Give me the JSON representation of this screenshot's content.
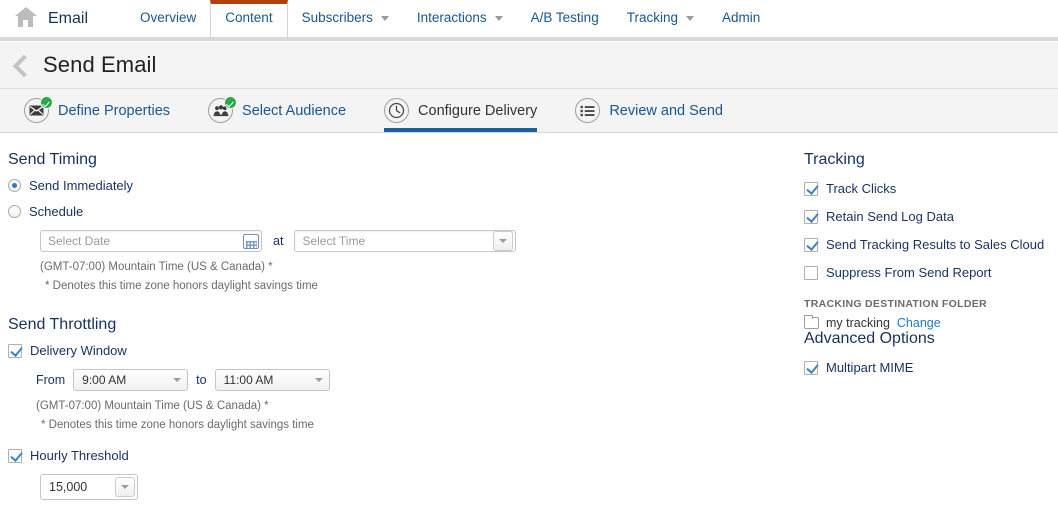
{
  "app": {
    "home_icon": "home-icon",
    "brand": "Email"
  },
  "nav": {
    "tabs": [
      {
        "label": "Overview",
        "has_caret": false,
        "active": false
      },
      {
        "label": "Content",
        "has_caret": false,
        "active": true
      },
      {
        "label": "Subscribers",
        "has_caret": true,
        "active": false
      },
      {
        "label": "Interactions",
        "has_caret": true,
        "active": false
      },
      {
        "label": "A/B Testing",
        "has_caret": false,
        "active": false
      },
      {
        "label": "Tracking",
        "has_caret": true,
        "active": false
      },
      {
        "label": "Admin",
        "has_caret": false,
        "active": false
      }
    ],
    "active_tab_accent": "#b1400d"
  },
  "header": {
    "back_icon": "back-chevron-icon",
    "title": "Send Email"
  },
  "steps": [
    {
      "label": "Define Properties",
      "icon": "envelope-icon",
      "complete": true,
      "active": false
    },
    {
      "label": "Select Audience",
      "icon": "audience-icon",
      "complete": true,
      "active": false
    },
    {
      "label": "Configure Delivery",
      "icon": "clock-icon",
      "complete": false,
      "active": true
    },
    {
      "label": "Review and Send",
      "icon": "list-icon",
      "complete": false,
      "active": false
    }
  ],
  "step_active_underline": "#1b5f9e",
  "send_timing": {
    "heading": "Send Timing",
    "options": [
      {
        "label": "Send Immediately",
        "selected": true
      },
      {
        "label": "Schedule",
        "selected": false
      }
    ],
    "date_placeholder": "Select Date",
    "at_label": "at",
    "time_placeholder": "Select Time",
    "timezone": "(GMT-07:00) Mountain Time (US & Canada) *",
    "timezone_note": "* Denotes this time zone honors daylight savings time"
  },
  "send_throttling": {
    "heading": "Send Throttling",
    "delivery_window": {
      "label": "Delivery Window",
      "checked": true
    },
    "from_label": "From",
    "from_value": "9:00 AM",
    "to_label": "to",
    "to_value": "11:00 AM",
    "timezone": "(GMT-07:00) Mountain Time (US & Canada) *",
    "timezone_note": "* Denotes this time zone honors daylight savings time",
    "hourly_threshold": {
      "label": "Hourly Threshold",
      "checked": true
    },
    "threshold_value": "15,000"
  },
  "tracking": {
    "heading": "Tracking",
    "options": [
      {
        "label": "Track Clicks",
        "checked": true
      },
      {
        "label": "Retain Send Log Data",
        "checked": true
      },
      {
        "label": "Send Tracking Results to Sales Cloud",
        "checked": true
      },
      {
        "label": "Suppress From Send Report",
        "checked": false
      }
    ],
    "folder_caption": "TRACKING DESTINATION FOLDER",
    "folder_name": "my tracking",
    "folder_change_label": "Change"
  },
  "advanced": {
    "heading": "Advanced Options",
    "options": [
      {
        "label": "Multipart MIME",
        "checked": true
      }
    ]
  }
}
